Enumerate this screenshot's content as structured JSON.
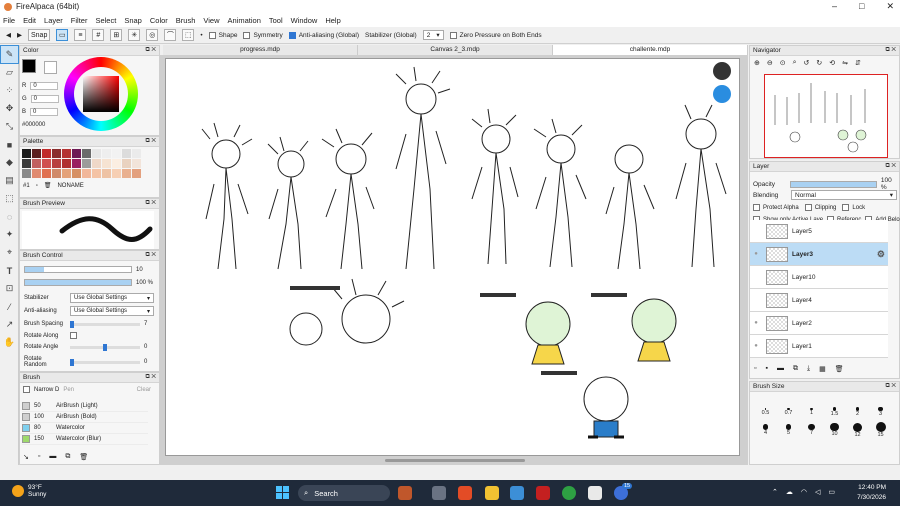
{
  "window": {
    "title": "FireAlpaca (64bit)",
    "min": "–",
    "max": "□",
    "close": "✕"
  },
  "menu": [
    "File",
    "Edit",
    "Layer",
    "Filter",
    "Select",
    "Snap",
    "Color",
    "Brush",
    "View",
    "Animation",
    "Tool",
    "Window",
    "Help"
  ],
  "toolbar": {
    "snap_label": "Snap",
    "shape_label": "Shape",
    "symmetry_label": "Symmetry",
    "antialias_label": "Anti-aliasing (Global)",
    "stabilizer_label": "Stabilizer (Global)",
    "stabilizer_value": "2",
    "zero_pressure_label": "Zero Pressure on Both Ends"
  },
  "color_panel": {
    "title": "Color",
    "r_label": "R",
    "r_value": "0",
    "g_label": "G",
    "g_value": "0",
    "b_label": "B",
    "b_value": "0",
    "hex": "#000000",
    "current_color": "#000000"
  },
  "palette": {
    "title": "Palette",
    "number": "#1",
    "name": "NONAME",
    "colors": [
      "#1a1a1a",
      "#5a1f1f",
      "#c02a2a",
      "#8a2d2d",
      "#b43333",
      "#6e1a55",
      "#6b6b6b",
      "#e7e7e7",
      "#eeeeee",
      "#f2f2f2",
      "#dcdcdc",
      "#ebebeb",
      "#3a3a3a",
      "#c06060",
      "#d05050",
      "#b84040",
      "#b03030",
      "#9a2060",
      "#9b9b9b",
      "#efd8c8",
      "#f6e3d2",
      "#fbeee2",
      "#e9d2c0",
      "#f2e4da",
      "#8a8a8a",
      "#e08a70",
      "#e07050",
      "#d08a6a",
      "#e4a27a",
      "#d69064",
      "#f1b79a",
      "#f4c3a5",
      "#eec3a5",
      "#f6cfb4",
      "#e9b08f",
      "#e3a07e"
    ]
  },
  "brush_preview": {
    "title": "Brush Preview"
  },
  "brush_control": {
    "title": "Brush Control",
    "size_value": "10",
    "opacity_value": "100 %",
    "size_fill": 0.18,
    "opacity_fill": 1.0,
    "stabilizer_label": "Stabilizer",
    "stabilizer_value": "Use Global Settings",
    "antialias_label": "Anti-aliasing",
    "antialias_value": "Use Global Settings",
    "spacing_label": "Brush Spacing",
    "spacing_value": "7",
    "rotate_along_label": "Rotate Along",
    "rotate_angle_label": "Rotate Angle",
    "rotate_angle_value": "0",
    "rotate_random_label": "Rotate Random",
    "rotate_random_value": "0"
  },
  "brush_panel": {
    "title": "Brush",
    "narrow_label": "Narrow D",
    "search_placeholder": "Pen",
    "clear_label": "Clear",
    "items": [
      {
        "size": "50",
        "name": "AirBrush (Light)",
        "color": "#cfcfcf"
      },
      {
        "size": "100",
        "name": "AirBrush (Bold)",
        "color": "#cfcfcf"
      },
      {
        "size": "80",
        "name": "Watercolor",
        "color": "#7fd0ee"
      },
      {
        "size": "150",
        "name": "Watercolor (Blur)",
        "color": "#9ed96b"
      }
    ]
  },
  "tabs": [
    "progress.mdp",
    "Canvas 2_3.mdp",
    "challente.mdp"
  ],
  "navigator": {
    "title": "Navigator"
  },
  "layer_panel": {
    "title": "Layer",
    "opacity_label": "Opacity",
    "opacity_value": "100 %",
    "opacity_fill": 1.0,
    "blending_label": "Blending",
    "blending_value": "Normal",
    "protect_alpha": "Protect Alpha",
    "clipping": "Clipping",
    "lock": "Lock",
    "show_active": "Show only Active Laye",
    "reference": "Referenc",
    "add_below": "Add Belo",
    "layers": [
      "Layer5",
      "Layer3",
      "Layer10",
      "Layer4",
      "Layer2",
      "Layer1"
    ]
  },
  "brush_size_panel": {
    "title": "Brush Size",
    "sizes": [
      "0.5",
      "0.7",
      "1",
      "1.5",
      "2",
      "3",
      "4",
      "5",
      "7",
      "10",
      "12",
      "15"
    ]
  },
  "taskbar": {
    "temperature": "93°F",
    "weather": "Sunny",
    "search_label": "Search",
    "time": "12:40 PM",
    "date": "7/30/2026",
    "badge": "15"
  }
}
